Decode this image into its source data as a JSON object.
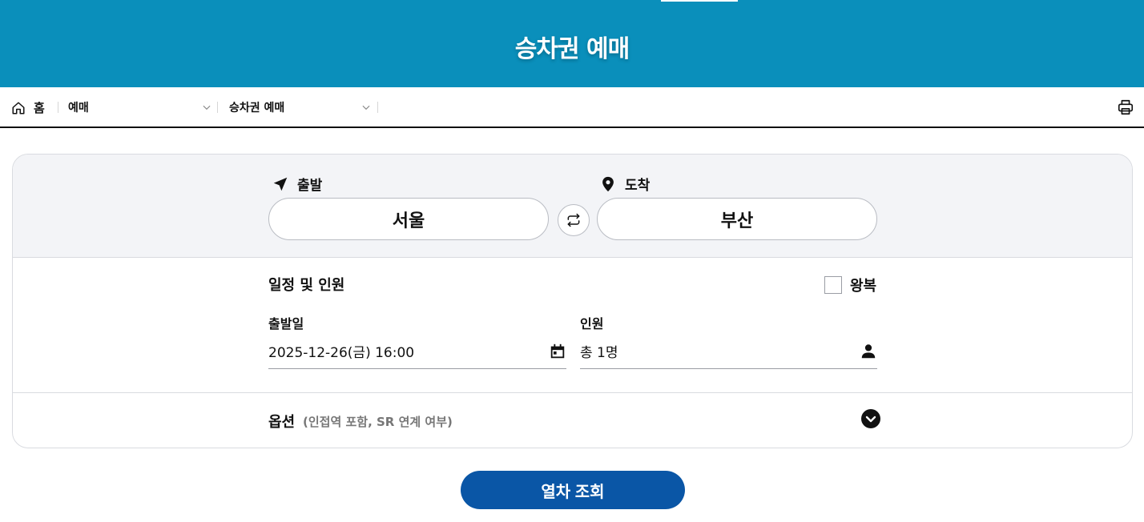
{
  "header": {
    "title": "승차권 예매"
  },
  "breadcrumb": {
    "home_label": "홈",
    "level1": "예매",
    "level2": "승차권 예매"
  },
  "route": {
    "departure_label": "출발",
    "departure_value": "서울",
    "arrival_label": "도착",
    "arrival_value": "부산"
  },
  "schedule": {
    "title": "일정 및 인원",
    "roundtrip_label": "왕복",
    "roundtrip_checked": false,
    "date_label": "출발일",
    "date_value": "2025-12-26(금) 16:00",
    "people_label": "인원",
    "people_value": "총 1명"
  },
  "options": {
    "label": "옵션",
    "hint": "(인접역 포함, SR 연계 여부)"
  },
  "search_button": "열차 조회",
  "colors": {
    "header_bg": "#0a8fbb",
    "button_bg": "#0a56a6",
    "route_bg": "#f3f4f7"
  }
}
